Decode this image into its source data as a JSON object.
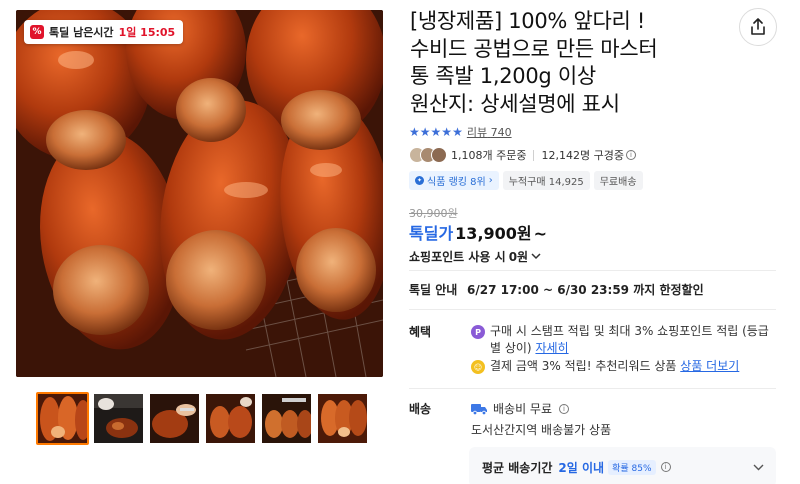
{
  "gallery": {
    "badge_label": "톡딜 남은시간",
    "badge_timer": "1일 15:05",
    "thumb_count": 6,
    "selected_thumb": 1
  },
  "product": {
    "title_lines": [
      "[냉장제품] 100% 앞다리 !",
      "수비드 공법으로 만든 마스터",
      "통 족발 1,200g 이상",
      "원산지: 상세설명에 표시"
    ],
    "rating_stars": 5,
    "review_label": "리뷰",
    "review_count": "740",
    "orders_text": "1,108개 주문중",
    "watchers_text": "12,142명 구경중",
    "chips": {
      "rank": "식품 랭킹 8위",
      "cumulative": "누적구매 14,925",
      "free_shipping": "무료배송"
    },
    "original_price": "30,900원",
    "price_label": "톡딜가",
    "price": "13,900원",
    "price_suffix": "~",
    "points_text": "쇼핑포인트 사용 시",
    "points_value": "0원"
  },
  "deal": {
    "label": "톡딜 안내",
    "value": "6/27 17:00 ~ 6/30 23:59 까지 한정할인"
  },
  "benefits": {
    "label": "혜택",
    "item1_text": "구매 시 스탬프 적립 및 최대 3% 쇼핑포인트 적립 (등급별 상이)",
    "item1_link": "자세히",
    "item2_text": "결제 금액 3% 적립! 추천리워드 상품",
    "item2_link": "상품 더보기"
  },
  "shipping": {
    "label": "배송",
    "fee_text": "배송비 무료",
    "restriction_text": "도서산간지역 배송불가 상품",
    "avg_label": "평균 배송기간",
    "avg_value": "2일 이내",
    "probability": "확률 85%"
  },
  "colors": {
    "accent_blue": "#2668e3",
    "deal_red": "#e0142b",
    "thumb_selected": "#ff7a00",
    "star_blue": "#3d6fd8"
  },
  "icons": [
    "percent-icon",
    "share-icon",
    "star-icon",
    "info-icon",
    "rank-icon",
    "chevron-down-icon",
    "points-icon",
    "reward-icon",
    "truck-icon"
  ]
}
